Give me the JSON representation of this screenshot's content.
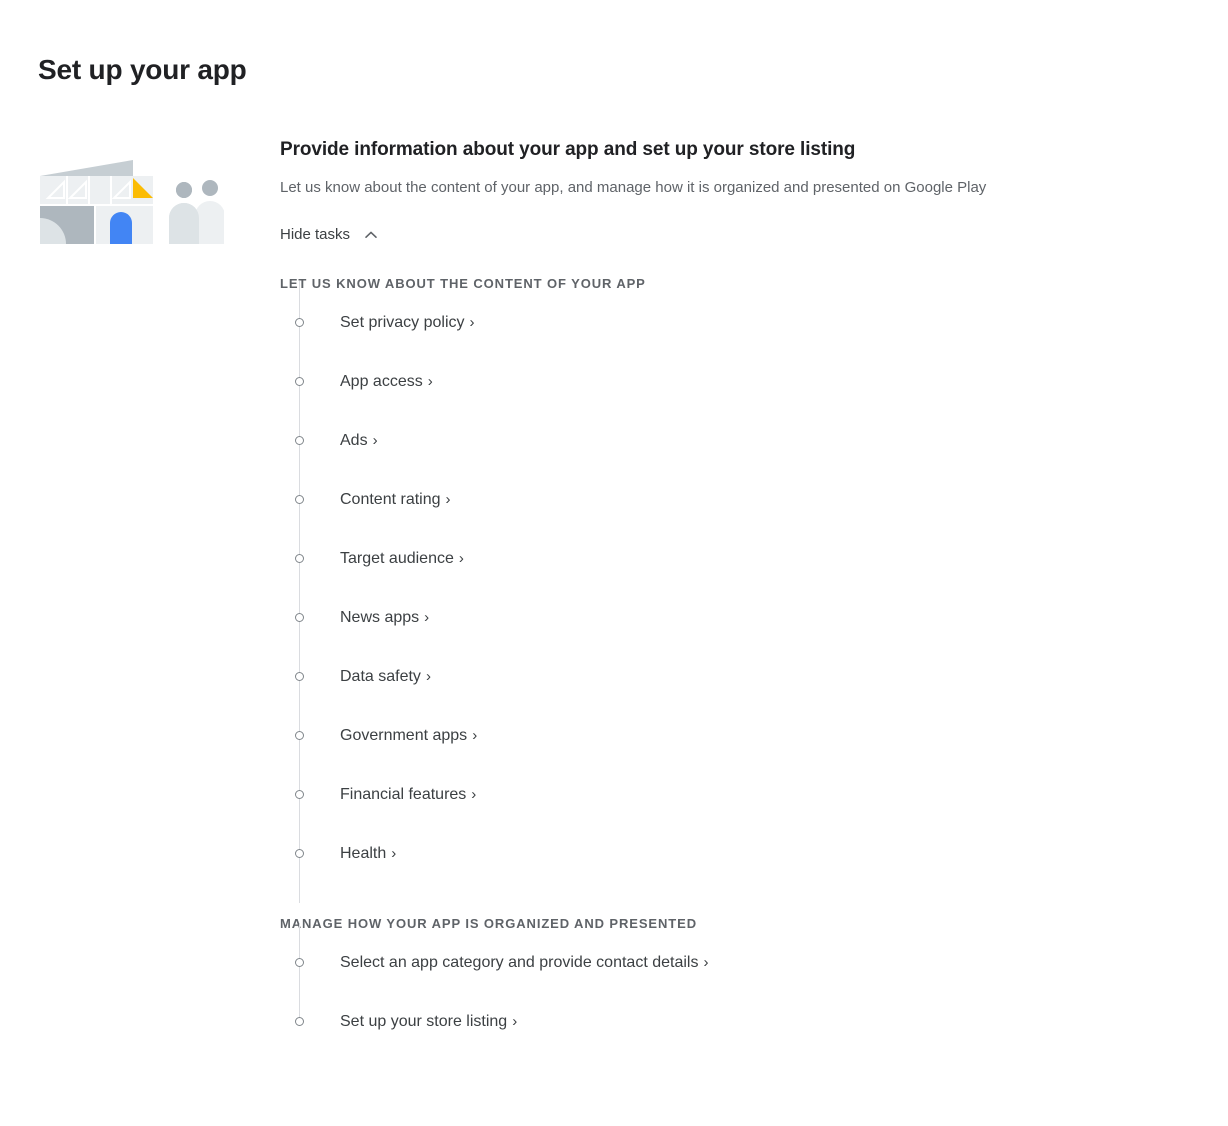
{
  "page": {
    "title": "Set up your app"
  },
  "illustration": {
    "name": "store-building-people-illustration",
    "colors": {
      "blue": "#4285F4",
      "yellow": "#FBBC04",
      "grey_dark": "#AEB7BE",
      "grey_mid": "#C6CED3",
      "grey_light": "#DDE3E6",
      "grey_pale": "#EDF0F2"
    }
  },
  "card": {
    "title": "Provide information about your app and set up your store listing",
    "description": "Let us know about the content of your app, and manage how it is organized and presented on Google Play",
    "toggle": {
      "label": "Hide tasks",
      "icon": "chevron-up-icon"
    }
  },
  "sections": [
    {
      "header": "LET US KNOW ABOUT THE CONTENT OF YOUR APP",
      "tasks": [
        {
          "label": "Set privacy policy",
          "chevron": "›",
          "status": "incomplete"
        },
        {
          "label": "App access",
          "chevron": "›",
          "status": "incomplete"
        },
        {
          "label": "Ads",
          "chevron": "›",
          "status": "incomplete"
        },
        {
          "label": "Content rating",
          "chevron": "›",
          "status": "incomplete"
        },
        {
          "label": "Target audience",
          "chevron": "›",
          "status": "incomplete"
        },
        {
          "label": "News apps",
          "chevron": "›",
          "status": "incomplete"
        },
        {
          "label": "Data safety",
          "chevron": "›",
          "status": "incomplete"
        },
        {
          "label": "Government apps",
          "chevron": "›",
          "status": "incomplete"
        },
        {
          "label": "Financial features",
          "chevron": "›",
          "status": "incomplete"
        },
        {
          "label": "Health",
          "chevron": "›",
          "status": "incomplete"
        }
      ]
    },
    {
      "header": "MANAGE HOW YOUR APP IS ORGANIZED AND PRESENTED",
      "tasks": [
        {
          "label": "Select an app category and provide contact details",
          "chevron": "›",
          "status": "incomplete"
        },
        {
          "label": "Set up your store listing",
          "chevron": "›",
          "status": "incomplete"
        }
      ]
    }
  ]
}
